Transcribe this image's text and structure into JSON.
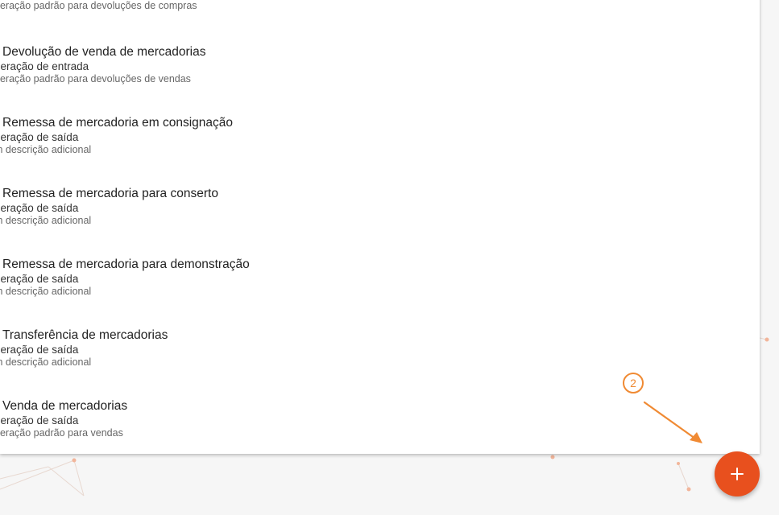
{
  "operations": [
    {
      "title": "",
      "type": "",
      "description": "peração padrão para devoluções de compras"
    },
    {
      "title": "Devolução de venda de mercadorias",
      "type": "peração de entrada",
      "description": "peração padrão para devoluções de vendas"
    },
    {
      "title": "Remessa de mercadoria em consignação",
      "type": "peração de saída",
      "description": "m descrição adicional"
    },
    {
      "title": "Remessa de mercadoria para conserto",
      "type": "peração de saída",
      "description": "m descrição adicional"
    },
    {
      "title": "Remessa de mercadoria para demonstração",
      "type": "peração de saída",
      "description": "m descrição adicional"
    },
    {
      "title": "Transferência de mercadorias",
      "type": "peração de saída",
      "description": "m descrição adicional"
    },
    {
      "title": "Venda de mercadorias",
      "type": "peração de saída",
      "description": "peração padrão para vendas"
    }
  ],
  "fab": {
    "icon": "plus-icon",
    "color": "#e8501e"
  },
  "annotation": {
    "step_number": "2",
    "color": "#f08a33"
  }
}
